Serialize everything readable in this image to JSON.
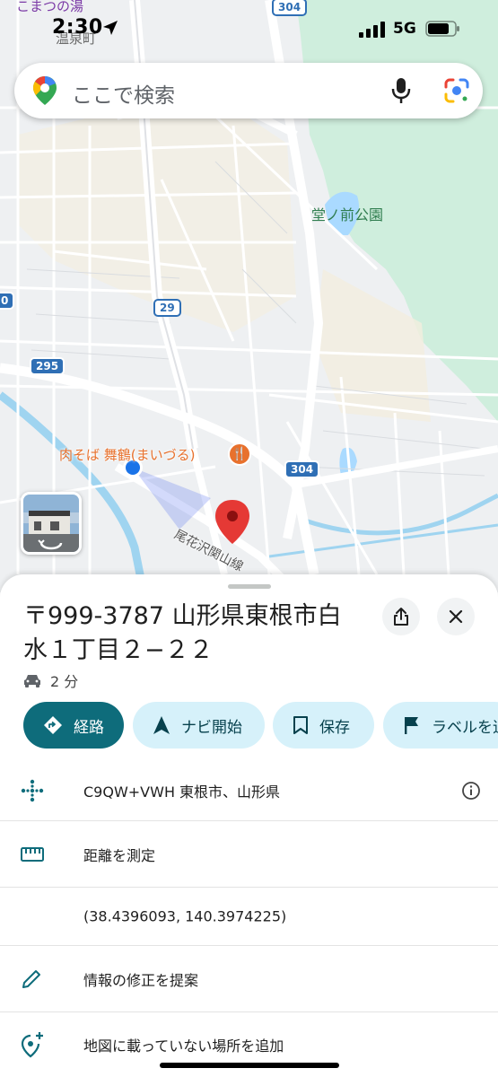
{
  "status_bar": {
    "time": "2:30",
    "network": "5G"
  },
  "search": {
    "placeholder": "ここで検索",
    "icons": [
      "google-maps-logo-icon",
      "microphone-icon",
      "google-lens-icon"
    ]
  },
  "map": {
    "top_name": "こまつの湯",
    "onsen_name": "温泉町",
    "park_name": "堂ノ前公園",
    "poi_name": "肉そば 舞鶴(まいづる)",
    "line_name": "尾花沢関山線",
    "shields": {
      "r304_top": "304",
      "r29": "29",
      "r295": "295",
      "r304_mid": "304",
      "left_edge": "0"
    },
    "colors": {
      "park": "#cfeedd",
      "water": "#aadaff",
      "river": "#9fd4f0",
      "pin": "#e53935",
      "my_location": "#1a73e8"
    }
  },
  "place": {
    "title": "〒999-3787 山形県東根市白水１丁目２−２２",
    "eta": "2 分"
  },
  "actions": [
    {
      "label": "経路",
      "icon": "directions-icon"
    },
    {
      "label": "ナビ開始",
      "icon": "navigation-arrow-icon"
    },
    {
      "label": "保存",
      "icon": "bookmark-icon"
    },
    {
      "label": "ラベルを追",
      "icon": "flag-icon"
    }
  ],
  "details": {
    "plus_code": "C9QW+VWH 東根市、山形県",
    "measure": "距離を測定",
    "coordinates": "(38.4396093, 140.3974225)",
    "suggest_edit": "情報の修正を提案",
    "add_place": "地図に載っていない場所を追加"
  }
}
